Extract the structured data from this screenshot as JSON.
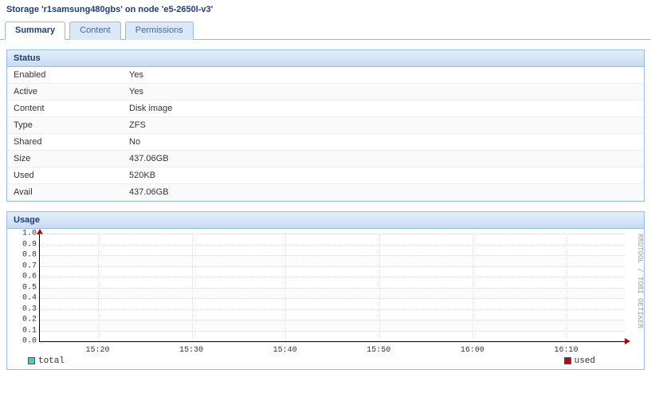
{
  "title": "Storage 'r1samsung480gbs' on node 'e5-2650l-v3'",
  "tabs": [
    {
      "label": "Summary",
      "active": true
    },
    {
      "label": "Content",
      "active": false
    },
    {
      "label": "Permissions",
      "active": false
    }
  ],
  "status": {
    "header": "Status",
    "rows": [
      {
        "key": "Enabled",
        "value": "Yes"
      },
      {
        "key": "Active",
        "value": "Yes"
      },
      {
        "key": "Content",
        "value": "Disk image"
      },
      {
        "key": "Type",
        "value": "ZFS"
      },
      {
        "key": "Shared",
        "value": "No"
      },
      {
        "key": "Size",
        "value": "437.06GB"
      },
      {
        "key": "Used",
        "value": "520KB"
      },
      {
        "key": "Avail",
        "value": "437.06GB"
      }
    ]
  },
  "usage": {
    "header": "Usage",
    "rrd_credit": "RRDTOOL / TOBI OETIKER",
    "legend": [
      {
        "name": "total",
        "color": "#4EC6C6"
      },
      {
        "name": "used",
        "color": "#C60000"
      }
    ]
  },
  "chart_data": {
    "type": "line",
    "title": "Usage",
    "ylabel": "",
    "xlabel": "",
    "ylim": [
      0.0,
      1.0
    ],
    "y_ticks": [
      "0.0",
      "0.1",
      "0.2",
      "0.3",
      "0.4",
      "0.5",
      "0.6",
      "0.7",
      "0.8",
      "0.9",
      "1.0"
    ],
    "x_ticks": [
      "15:20",
      "15:30",
      "15:40",
      "15:50",
      "16:00",
      "16:10"
    ],
    "series": [
      {
        "name": "total",
        "color": "#4EC6C6",
        "values": []
      },
      {
        "name": "used",
        "color": "#C60000",
        "values": []
      }
    ]
  }
}
